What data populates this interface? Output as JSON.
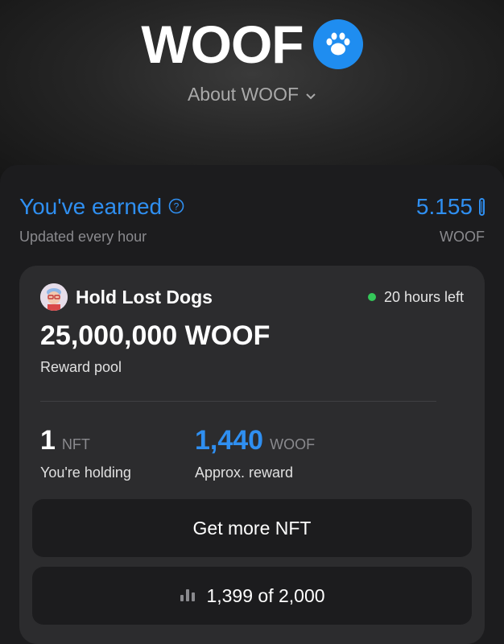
{
  "header": {
    "title": "WOOF",
    "about_label": "About WOOF"
  },
  "earned": {
    "label": "You've earned",
    "subtitle": "Updated every hour",
    "value": "5.155",
    "unit": "WOOF"
  },
  "card": {
    "title": "Hold Lost Dogs",
    "time_left": "20 hours left",
    "pool_value": "25,000,000 WOOF",
    "pool_label": "Reward pool",
    "holding_value": "1",
    "holding_unit": "NFT",
    "holding_label": "You're holding",
    "reward_value": "1,440",
    "reward_unit": "WOOF",
    "reward_label": "Approx. reward",
    "get_more_button": "Get more NFT",
    "progress_text": "1,399 of 2,000"
  },
  "colors": {
    "accent": "#2f8ff1",
    "status_green": "#34c759",
    "background": "#141414",
    "card": "#2c2c2e"
  },
  "icons": {
    "brand": "paw-icon",
    "about": "chevron-down-icon",
    "info": "question-circle-icon",
    "status": "green-dot",
    "progress": "bar-chart-icon"
  }
}
